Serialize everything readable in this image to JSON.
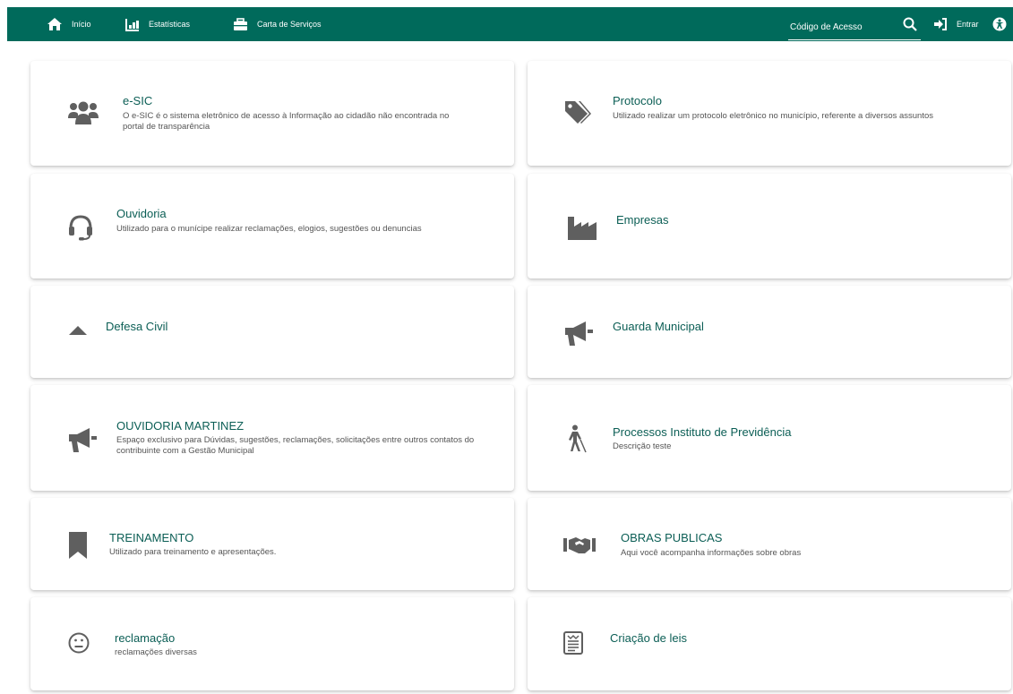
{
  "nav": {
    "home_label": "Início",
    "stats_label": "Estatísticas",
    "services_label": "Carta de Serviços",
    "search_placeholder": "Código de Acesso",
    "login_label": "Entrar"
  },
  "colors": {
    "header_bg": "#006a5b",
    "title_color": "#0b5e55",
    "icon_color": "#5f5f5f"
  },
  "cards": [
    {
      "title": "e-SIC",
      "desc": "O e-SIC é o sistema eletrônico de acesso à Informação ao cidadão não encontrada no portal de transparência",
      "icon": "users-icon"
    },
    {
      "title": "Protocolo",
      "desc": "Utilizado realizar um protocolo eletrônico no município, referente a diversos assuntos",
      "icon": "tags-icon"
    },
    {
      "title": "Ouvidoria",
      "desc": "Utilizado para o munícipe realizar reclamações, elogios, sugestões ou denuncias",
      "icon": "headset-icon"
    },
    {
      "title": "Empresas",
      "desc": "",
      "icon": "industry-icon"
    },
    {
      "title": "Defesa Civil",
      "desc": "",
      "icon": "triangle-icon"
    },
    {
      "title": "Guarda Municipal",
      "desc": "",
      "icon": "bullhorn-icon"
    },
    {
      "title": "OUVIDORIA MARTINEZ",
      "desc": "Espaço exclusivo para Dúvidas, sugestões, reclamações, solicitações entre outros contatos do contribuinte com a Gestão Municipal",
      "icon": "bullhorn-icon"
    },
    {
      "title": "Processos Instituto de Previdência",
      "desc": "Descrição teste",
      "icon": "person-cane-icon"
    },
    {
      "title": "TREINAMENTO",
      "desc": "Utilizado para treinamento e apresentações.",
      "icon": "bookmark-icon"
    },
    {
      "title": "OBRAS PUBLICAS",
      "desc": "Aqui você acompanha informações sobre obras",
      "icon": "handshake-icon"
    },
    {
      "title": "reclamação",
      "desc": "reclamações diversas",
      "icon": "meh-face-icon"
    },
    {
      "title": "Criação de leis",
      "desc": "",
      "icon": "newspaper-icon"
    }
  ]
}
